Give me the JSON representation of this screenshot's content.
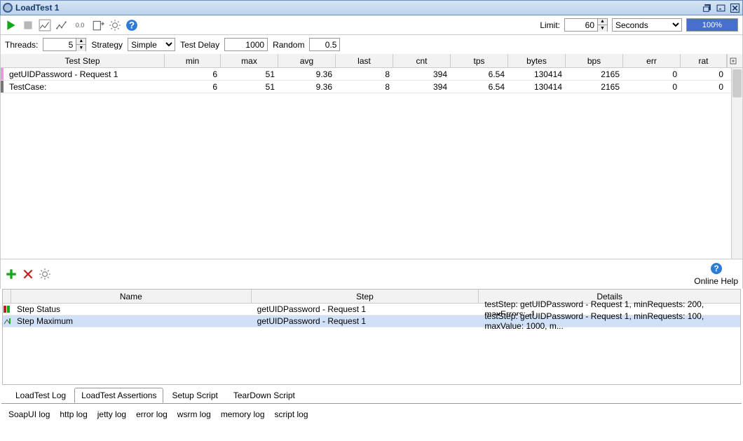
{
  "title": "LoadTest 1",
  "toolbar": {
    "limit_label": "Limit:",
    "limit_value": "60",
    "limit_unit": "Seconds",
    "progress": "100%"
  },
  "strategy": {
    "threads_label": "Threads:",
    "threads_value": "5",
    "strategy_label": "Strategy",
    "strategy_value": "Simple",
    "delay_label": "Test Delay",
    "delay_value": "1000",
    "random_label": "Random",
    "random_value": "0.5"
  },
  "grid": {
    "headers": [
      "Test Step",
      "min",
      "max",
      "avg",
      "last",
      "cnt",
      "tps",
      "bytes",
      "bps",
      "err",
      "rat"
    ],
    "rows": [
      {
        "step": "getUIDPassword - Request 1",
        "min": "6",
        "max": "51",
        "avg": "9.36",
        "last": "8",
        "cnt": "394",
        "tps": "6.54",
        "bytes": "130414",
        "bps": "2165",
        "err": "0",
        "rat": "0"
      },
      {
        "step": "TestCase:",
        "min": "6",
        "max": "51",
        "avg": "9.36",
        "last": "8",
        "cnt": "394",
        "tps": "6.54",
        "bytes": "130414",
        "bps": "2165",
        "err": "0",
        "rat": "0"
      }
    ]
  },
  "help_label": "Online Help",
  "assertions": {
    "headers": [
      "Name",
      "Step",
      "Details"
    ],
    "rows": [
      {
        "name": "Step Status",
        "step": "getUIDPassword - Request 1",
        "details": "testStep: getUIDPassword - Request 1, minRequests: 200, maxErrors: -1"
      },
      {
        "name": "Step Maximum",
        "step": "getUIDPassword - Request 1",
        "details": "testStep: getUIDPassword - Request 1, minRequests: 100, maxValue: 1000, m..."
      }
    ]
  },
  "tabs": [
    "LoadTest Log",
    "LoadTest Assertions",
    "Setup Script",
    "TearDown Script"
  ],
  "active_tab": 1,
  "logs": [
    "SoapUI log",
    "http log",
    "jetty log",
    "error log",
    "wsrm log",
    "memory log",
    "script log"
  ]
}
